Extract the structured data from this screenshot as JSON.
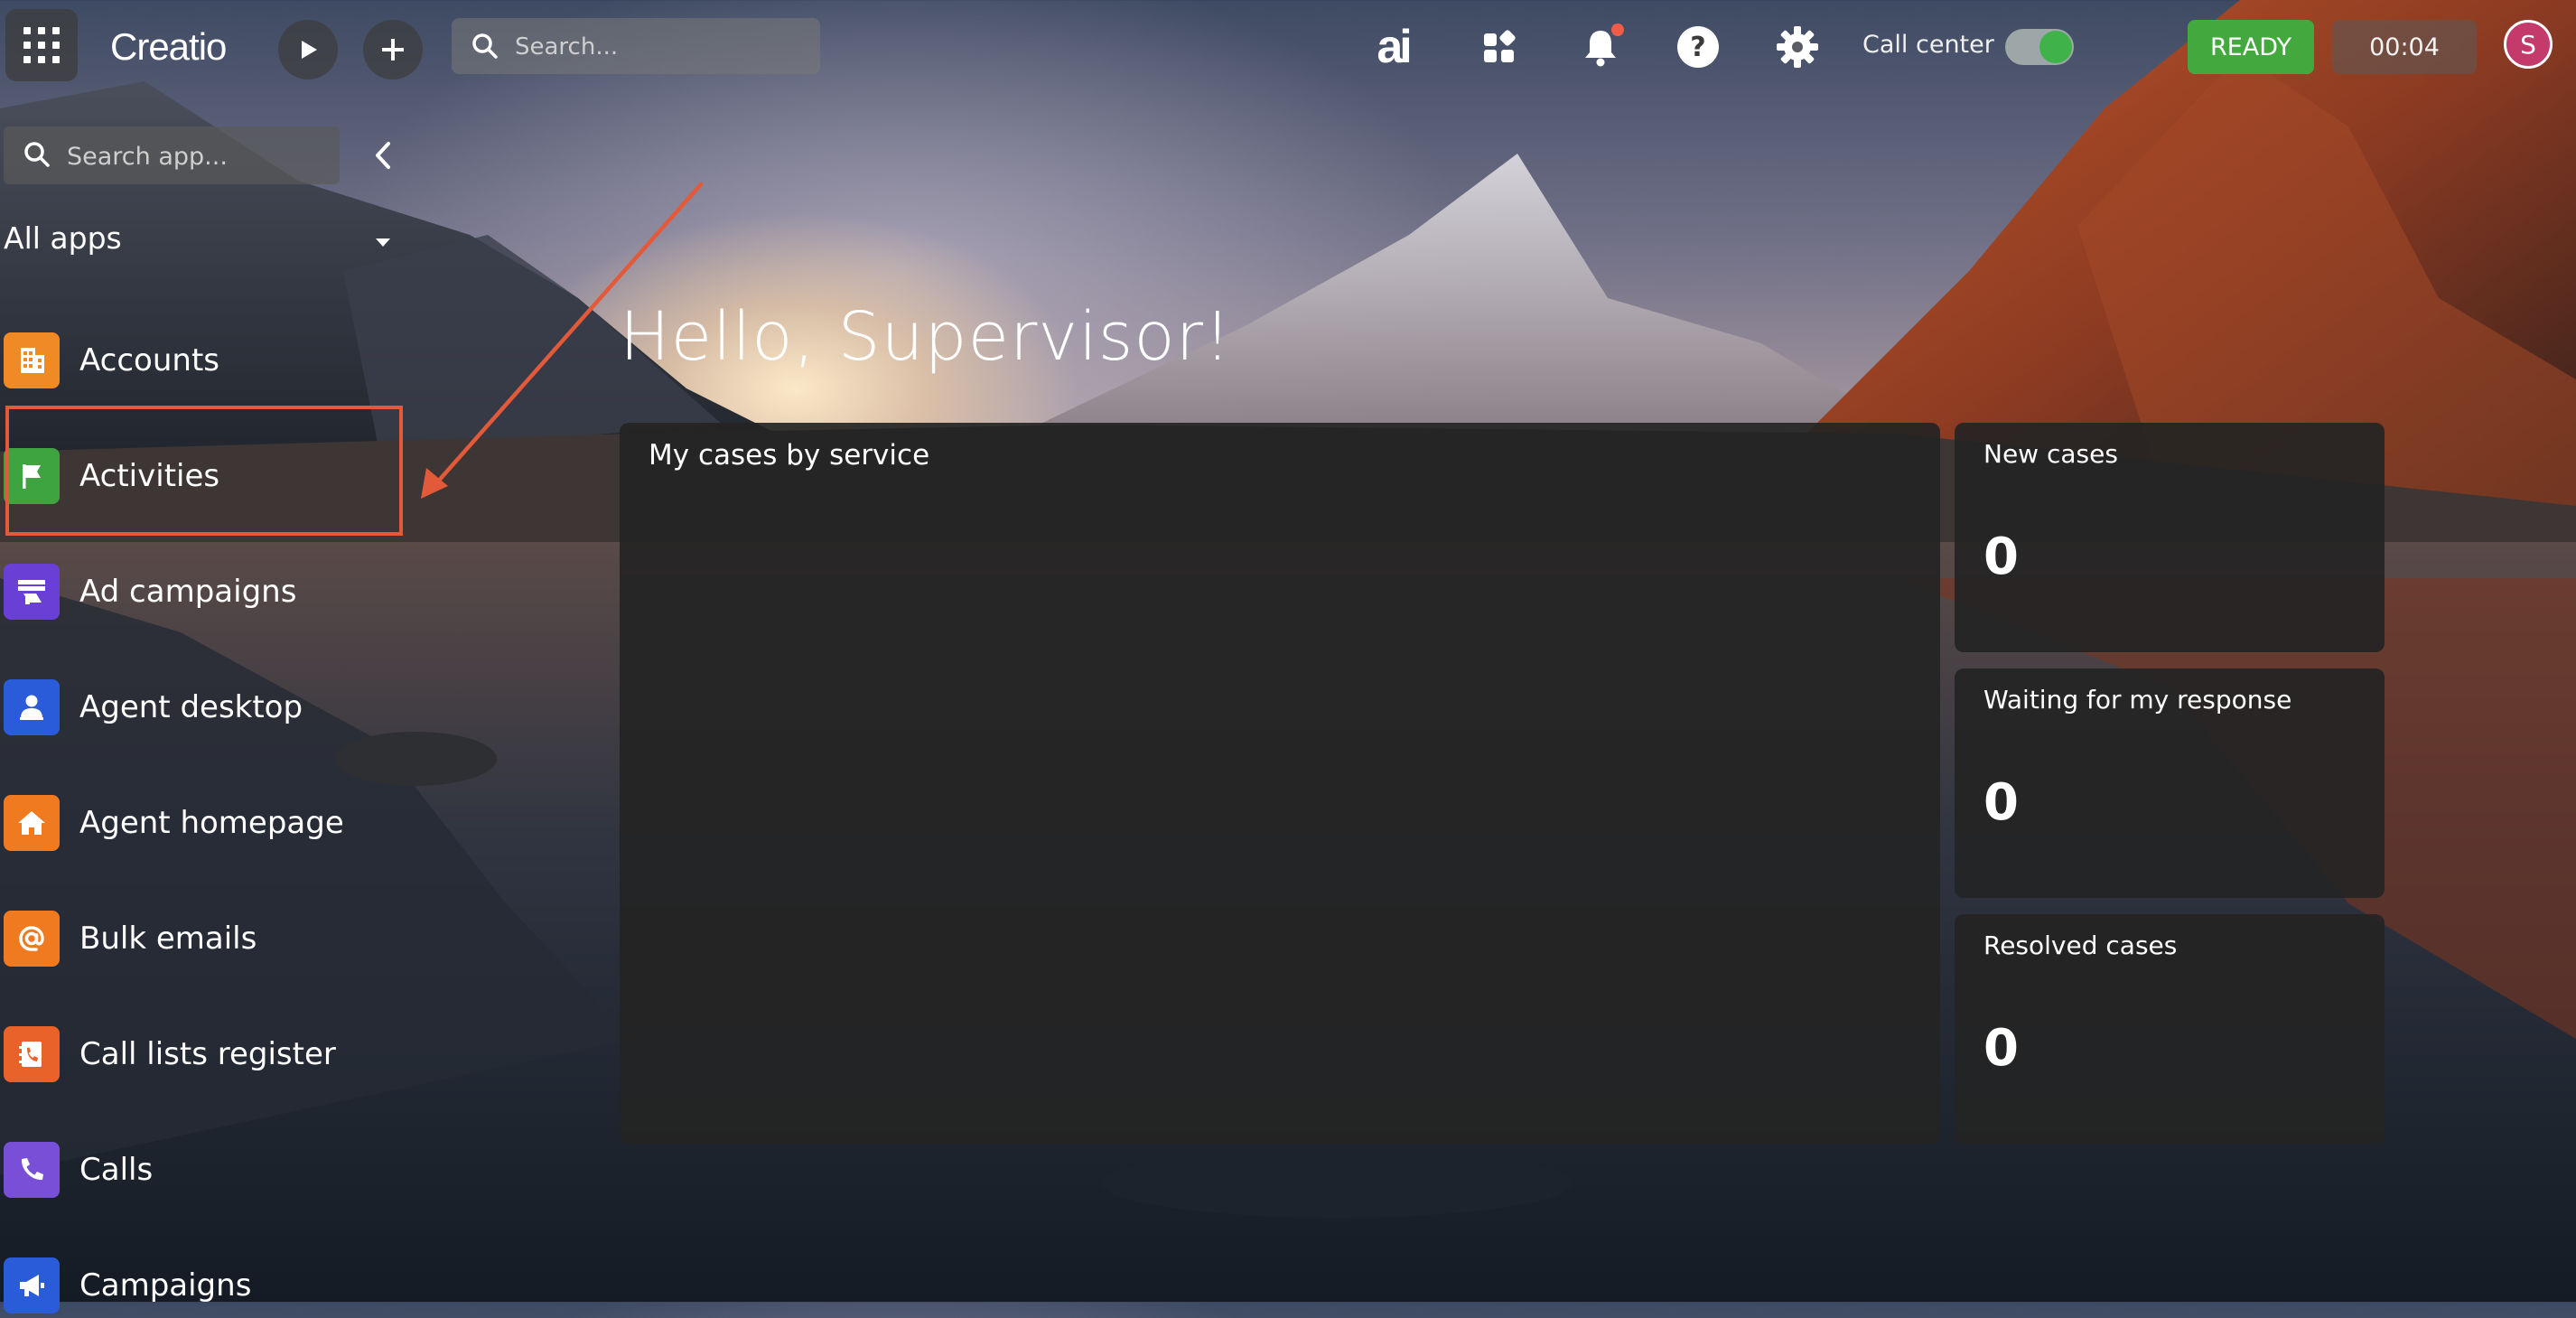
{
  "topbar": {
    "logo": "Creatio",
    "search_placeholder": "Search...",
    "ai_label": "ai",
    "call_center_label": "Call center",
    "call_center_on": true,
    "status_label": "READY",
    "status_color": "#43a93f",
    "timer": "00:04",
    "avatar_initial": "S",
    "notification_dot_color": "#f05c48"
  },
  "sidebar": {
    "search_placeholder": "Search app...",
    "all_apps_label": "All apps",
    "items": [
      {
        "label": "Accounts",
        "icon": "building-icon",
        "color": "#f08a24"
      },
      {
        "label": "Activities",
        "icon": "flag-icon",
        "color": "#3da43f"
      },
      {
        "label": "Ad campaigns",
        "icon": "megaphone-board-icon",
        "color": "#6a3fd6"
      },
      {
        "label": "Agent desktop",
        "icon": "agent-icon",
        "color": "#2a5bd8"
      },
      {
        "label": "Agent homepage",
        "icon": "home-icon",
        "color": "#f07a20"
      },
      {
        "label": "Bulk emails",
        "icon": "at-sign-icon",
        "color": "#f07a20"
      },
      {
        "label": "Call lists register",
        "icon": "phone-book-icon",
        "color": "#e8622a"
      },
      {
        "label": "Calls",
        "icon": "phone-icon",
        "color": "#7a4fd8"
      },
      {
        "label": "Campaigns",
        "icon": "megaphone-icon",
        "color": "#2a5bd8"
      }
    ]
  },
  "main": {
    "greeting": "Hello, Supervisor!",
    "chart_panel_title": "My cases by service",
    "metrics": [
      {
        "label": "New cases",
        "value": "0"
      },
      {
        "label": "Waiting for my response",
        "value": "0"
      },
      {
        "label": "Resolved cases",
        "value": "0"
      }
    ]
  },
  "annotation": {
    "highlight_color": "#e25a3a"
  }
}
